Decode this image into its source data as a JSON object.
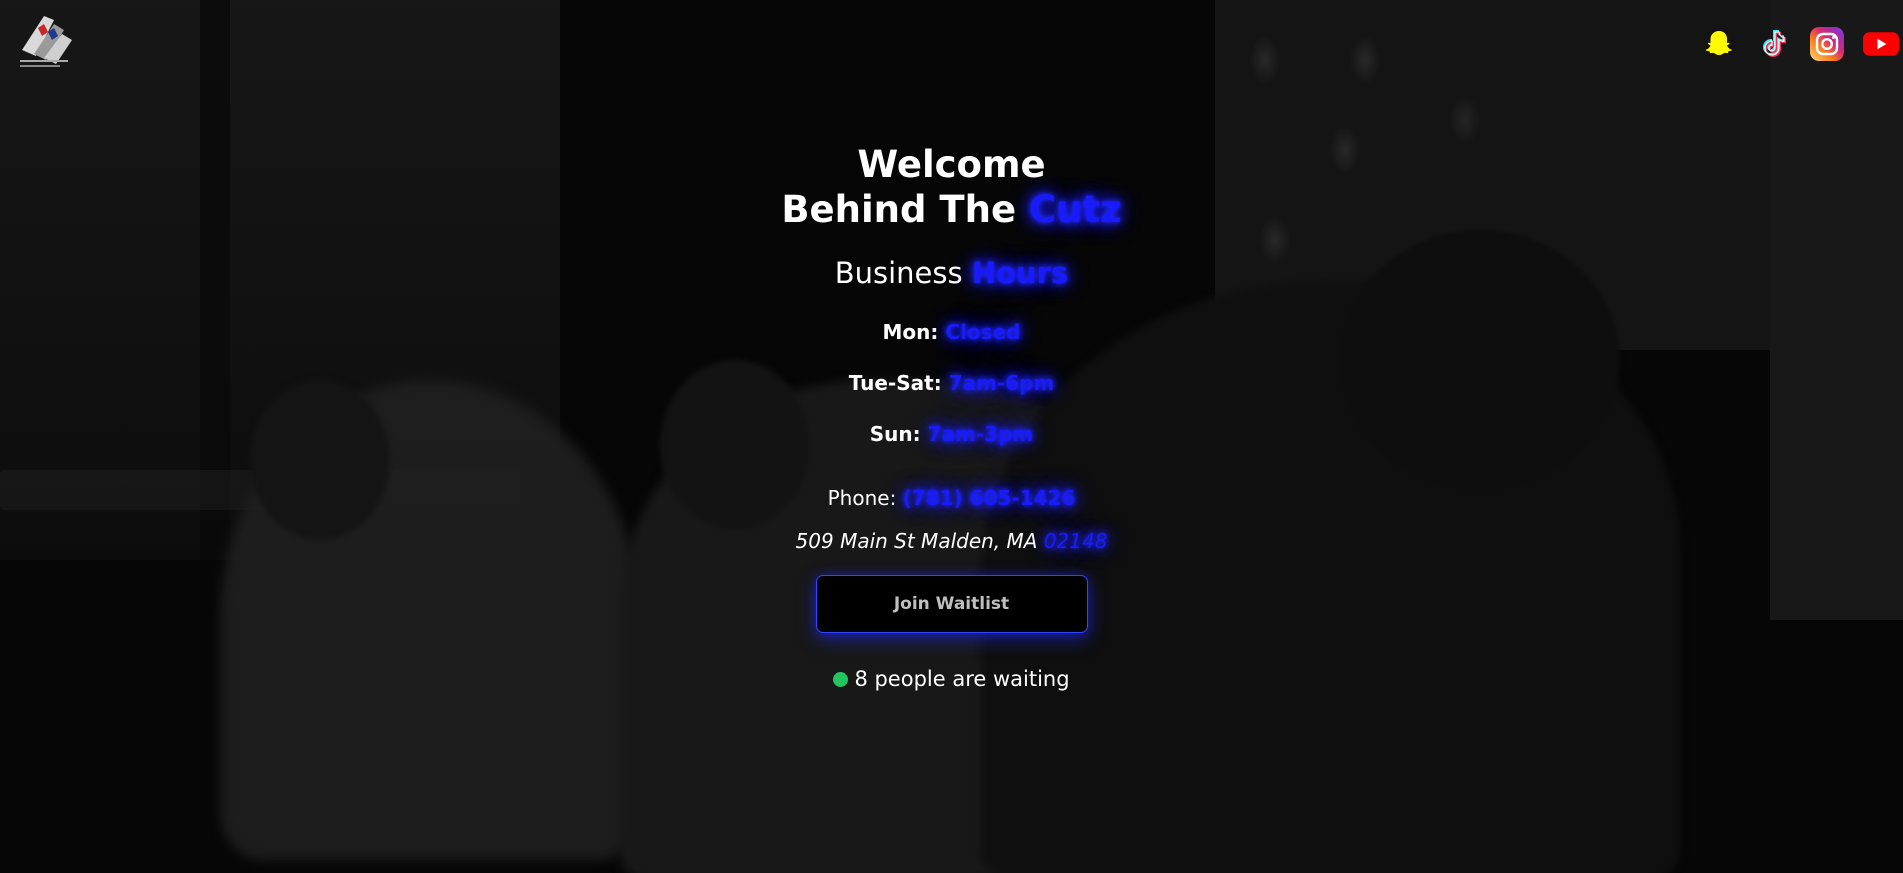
{
  "header": {
    "logo_icon": "barbershop-logo",
    "socials": [
      {
        "name": "snapchat-icon",
        "color": "#FFFC00"
      },
      {
        "name": "tiktok-icon",
        "color": "#000000"
      },
      {
        "name": "instagram-icon",
        "color": "#E1306C"
      },
      {
        "name": "youtube-icon",
        "color": "#FF0000"
      }
    ]
  },
  "hero": {
    "welcome": "Welcome",
    "behind_the": "Behind The",
    "cutz": "Cutz",
    "business": "Business",
    "hours_word": "Hours",
    "hours": [
      {
        "day": "Mon:",
        "time": "Closed"
      },
      {
        "day": "Tue-Sat:",
        "time": "7am-6pm"
      },
      {
        "day": "Sun:",
        "time": "7am-3pm"
      }
    ],
    "phone_label": "Phone:",
    "phone_number": "(781) 605-1426",
    "address": "509 Main St Malden, MA",
    "zip": "02148",
    "join_button": "Join Waitlist",
    "waiting_text": "8 people are waiting"
  },
  "colors": {
    "accent": "#1a1aff",
    "status_online": "#22c55e"
  }
}
